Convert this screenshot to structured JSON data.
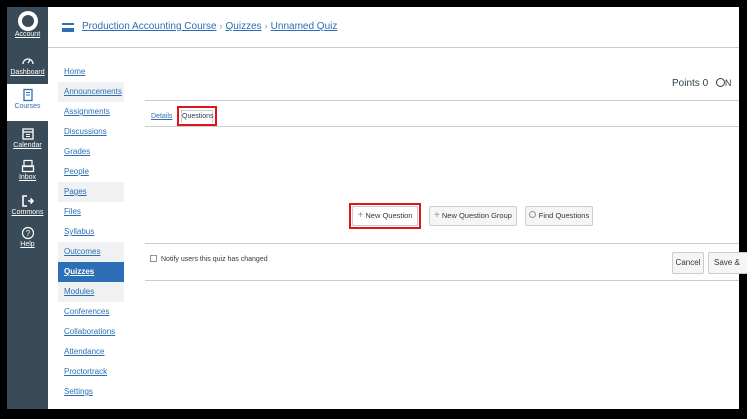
{
  "global_nav": {
    "account": "Account",
    "dashboard": "Dashboard",
    "courses": "Courses",
    "calendar": "Calendar",
    "inbox": "Inbox",
    "commons": "Commons",
    "help": "Help"
  },
  "breadcrumb": {
    "course": "Production Accounting Course",
    "section": "Quizzes",
    "page": "Unnamed Quiz",
    "separator": "›"
  },
  "course_nav": [
    {
      "label": "Home"
    },
    {
      "label": "Announcements"
    },
    {
      "label": "Assignments"
    },
    {
      "label": "Discussions"
    },
    {
      "label": "Grades"
    },
    {
      "label": "People"
    },
    {
      "label": "Pages"
    },
    {
      "label": "Files"
    },
    {
      "label": "Syllabus"
    },
    {
      "label": "Outcomes"
    },
    {
      "label": "Quizzes"
    },
    {
      "label": "Modules"
    },
    {
      "label": "Conferences"
    },
    {
      "label": "Collaborations"
    },
    {
      "label": "Attendance"
    },
    {
      "label": "Proctortrack"
    },
    {
      "label": "Settings"
    }
  ],
  "quiz": {
    "points_label": "Points",
    "points_value": "0",
    "points_trail": "N"
  },
  "tabs": {
    "details": "Details",
    "questions": "Questions"
  },
  "actions": {
    "new_question": "New Question",
    "new_question_group": "New Question Group",
    "find_questions": "Find Questions"
  },
  "footer": {
    "notify_label": "Notify users this quiz has changed",
    "cancel": "Cancel",
    "save": "Save &"
  },
  "colors": {
    "nav_bg": "#394b58",
    "link": "#2d6fb4",
    "highlight": "#e0141d"
  }
}
